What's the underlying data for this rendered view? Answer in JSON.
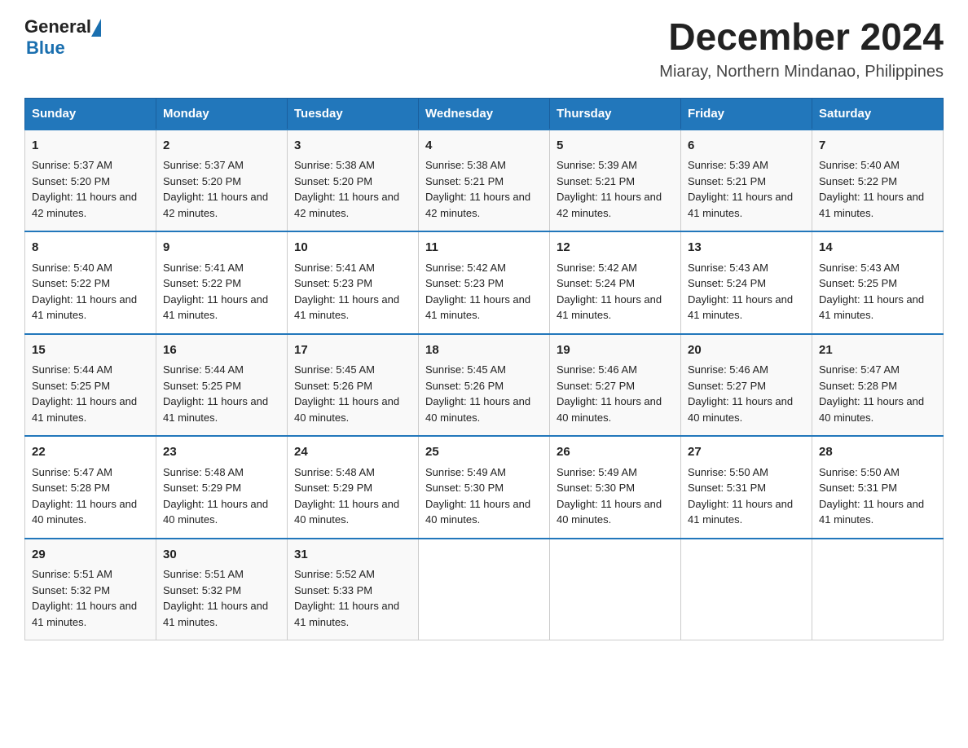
{
  "header": {
    "logo_general": "General",
    "logo_blue": "Blue",
    "main_title": "December 2024",
    "subtitle": "Miaray, Northern Mindanao, Philippines"
  },
  "days_of_week": [
    "Sunday",
    "Monday",
    "Tuesday",
    "Wednesday",
    "Thursday",
    "Friday",
    "Saturday"
  ],
  "weeks": [
    [
      {
        "day": "1",
        "sunrise": "5:37 AM",
        "sunset": "5:20 PM",
        "daylight": "11 hours and 42 minutes."
      },
      {
        "day": "2",
        "sunrise": "5:37 AM",
        "sunset": "5:20 PM",
        "daylight": "11 hours and 42 minutes."
      },
      {
        "day": "3",
        "sunrise": "5:38 AM",
        "sunset": "5:20 PM",
        "daylight": "11 hours and 42 minutes."
      },
      {
        "day": "4",
        "sunrise": "5:38 AM",
        "sunset": "5:21 PM",
        "daylight": "11 hours and 42 minutes."
      },
      {
        "day": "5",
        "sunrise": "5:39 AM",
        "sunset": "5:21 PM",
        "daylight": "11 hours and 42 minutes."
      },
      {
        "day": "6",
        "sunrise": "5:39 AM",
        "sunset": "5:21 PM",
        "daylight": "11 hours and 41 minutes."
      },
      {
        "day": "7",
        "sunrise": "5:40 AM",
        "sunset": "5:22 PM",
        "daylight": "11 hours and 41 minutes."
      }
    ],
    [
      {
        "day": "8",
        "sunrise": "5:40 AM",
        "sunset": "5:22 PM",
        "daylight": "11 hours and 41 minutes."
      },
      {
        "day": "9",
        "sunrise": "5:41 AM",
        "sunset": "5:22 PM",
        "daylight": "11 hours and 41 minutes."
      },
      {
        "day": "10",
        "sunrise": "5:41 AM",
        "sunset": "5:23 PM",
        "daylight": "11 hours and 41 minutes."
      },
      {
        "day": "11",
        "sunrise": "5:42 AM",
        "sunset": "5:23 PM",
        "daylight": "11 hours and 41 minutes."
      },
      {
        "day": "12",
        "sunrise": "5:42 AM",
        "sunset": "5:24 PM",
        "daylight": "11 hours and 41 minutes."
      },
      {
        "day": "13",
        "sunrise": "5:43 AM",
        "sunset": "5:24 PM",
        "daylight": "11 hours and 41 minutes."
      },
      {
        "day": "14",
        "sunrise": "5:43 AM",
        "sunset": "5:25 PM",
        "daylight": "11 hours and 41 minutes."
      }
    ],
    [
      {
        "day": "15",
        "sunrise": "5:44 AM",
        "sunset": "5:25 PM",
        "daylight": "11 hours and 41 minutes."
      },
      {
        "day": "16",
        "sunrise": "5:44 AM",
        "sunset": "5:25 PM",
        "daylight": "11 hours and 41 minutes."
      },
      {
        "day": "17",
        "sunrise": "5:45 AM",
        "sunset": "5:26 PM",
        "daylight": "11 hours and 40 minutes."
      },
      {
        "day": "18",
        "sunrise": "5:45 AM",
        "sunset": "5:26 PM",
        "daylight": "11 hours and 40 minutes."
      },
      {
        "day": "19",
        "sunrise": "5:46 AM",
        "sunset": "5:27 PM",
        "daylight": "11 hours and 40 minutes."
      },
      {
        "day": "20",
        "sunrise": "5:46 AM",
        "sunset": "5:27 PM",
        "daylight": "11 hours and 40 minutes."
      },
      {
        "day": "21",
        "sunrise": "5:47 AM",
        "sunset": "5:28 PM",
        "daylight": "11 hours and 40 minutes."
      }
    ],
    [
      {
        "day": "22",
        "sunrise": "5:47 AM",
        "sunset": "5:28 PM",
        "daylight": "11 hours and 40 minutes."
      },
      {
        "day": "23",
        "sunrise": "5:48 AM",
        "sunset": "5:29 PM",
        "daylight": "11 hours and 40 minutes."
      },
      {
        "day": "24",
        "sunrise": "5:48 AM",
        "sunset": "5:29 PM",
        "daylight": "11 hours and 40 minutes."
      },
      {
        "day": "25",
        "sunrise": "5:49 AM",
        "sunset": "5:30 PM",
        "daylight": "11 hours and 40 minutes."
      },
      {
        "day": "26",
        "sunrise": "5:49 AM",
        "sunset": "5:30 PM",
        "daylight": "11 hours and 40 minutes."
      },
      {
        "day": "27",
        "sunrise": "5:50 AM",
        "sunset": "5:31 PM",
        "daylight": "11 hours and 41 minutes."
      },
      {
        "day": "28",
        "sunrise": "5:50 AM",
        "sunset": "5:31 PM",
        "daylight": "11 hours and 41 minutes."
      }
    ],
    [
      {
        "day": "29",
        "sunrise": "5:51 AM",
        "sunset": "5:32 PM",
        "daylight": "11 hours and 41 minutes."
      },
      {
        "day": "30",
        "sunrise": "5:51 AM",
        "sunset": "5:32 PM",
        "daylight": "11 hours and 41 minutes."
      },
      {
        "day": "31",
        "sunrise": "5:52 AM",
        "sunset": "5:33 PM",
        "daylight": "11 hours and 41 minutes."
      },
      null,
      null,
      null,
      null
    ]
  ]
}
